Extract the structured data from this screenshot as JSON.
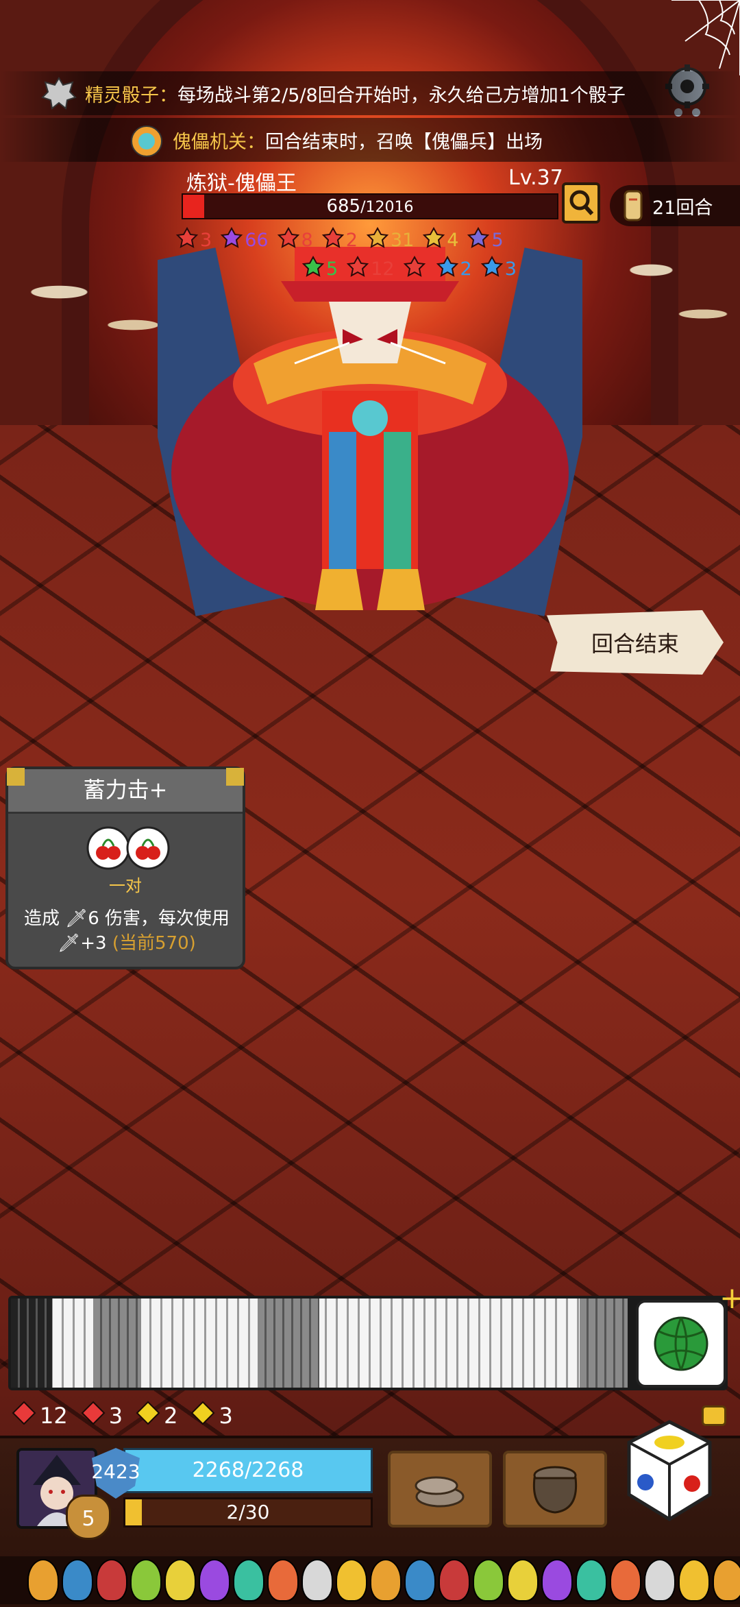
{
  "banners": [
    {
      "label": "精灵骰子：",
      "text": "每场战斗第2/5/8回合开始时，永久给己方增加1个骰子",
      "icon": "spirit-dice-icon"
    },
    {
      "label": "傀儡机关：",
      "text": "回合结束时，召唤【傀儡兵】出场",
      "icon": "puppet-mechanism-icon"
    }
  ],
  "boss": {
    "name": "炼狱-傀儡王",
    "level": "Lv.37",
    "hp_current": "685",
    "hp_max": "/12016",
    "hp_fraction": 0.057
  },
  "round": "21回合",
  "boss_status_row1": [
    {
      "icon": "burn-icon",
      "value": "3",
      "color": "#e8403a"
    },
    {
      "icon": "poison-icon",
      "value": "66",
      "color": "#9a4ae0"
    },
    {
      "icon": "bleed-icon",
      "value": "8",
      "color": "#e8403a"
    },
    {
      "icon": "curse-icon",
      "value": "2",
      "color": "#e8403a"
    },
    {
      "icon": "coin-icon",
      "value": "31",
      "color": "#e8b03a"
    },
    {
      "icon": "weak-icon",
      "value": "4",
      "color": "#e8c03a"
    },
    {
      "icon": "skull-icon",
      "value": "5",
      "color": "#7a6ad8"
    }
  ],
  "boss_status_row2": [
    {
      "icon": "spiral-icon",
      "value": "5",
      "color": "#3ac04a"
    },
    {
      "icon": "fire-icon",
      "value": "12",
      "color": "#e8403a"
    },
    {
      "icon": "hidden-icon",
      "value": "",
      "color": "#e8403a"
    },
    {
      "icon": "frost-skull-icon",
      "value": "2",
      "color": "#3a9ae8"
    },
    {
      "icon": "snowflake-icon",
      "value": "3",
      "color": "#3a9ae8"
    }
  ],
  "end_turn_label": "回合结束",
  "skill": {
    "title": "蓄力击+",
    "condition": "一对",
    "desc_prefix": "造成",
    "damage": "6 伤害，每次使用",
    "increment": "+3",
    "current": "(当前570)"
  },
  "player_stats": [
    {
      "icon": "attack-icon",
      "value": "12",
      "color": "#e83a3a"
    },
    {
      "icon": "shield-heart-icon",
      "value": "3",
      "color": "#e83a3a"
    },
    {
      "icon": "lightning-icon",
      "value": "2",
      "color": "#f0d020"
    },
    {
      "icon": "upgrade-icon",
      "value": "3",
      "color": "#f0d020"
    }
  ],
  "player": {
    "shield": "2423",
    "hp": "2268/2268",
    "xp": "2/30",
    "xp_fraction": 0.067,
    "gold": "5"
  },
  "colors": {
    "accent_gold": "#f6c64a",
    "hp_red": "#e8241e",
    "player_hp_blue": "#58c8f0"
  }
}
